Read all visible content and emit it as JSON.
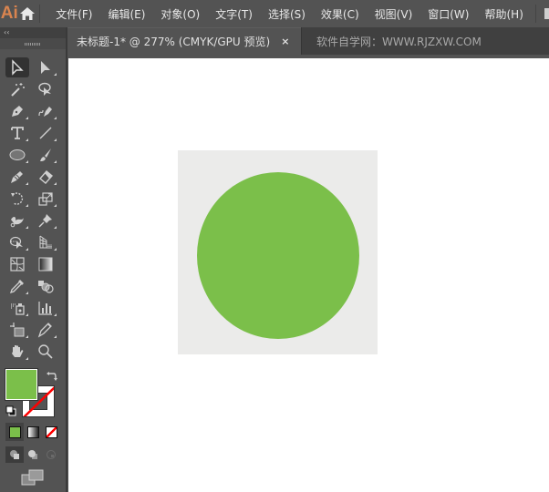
{
  "app": {
    "logo": "Ai",
    "menus": [
      {
        "label": "文件(F)"
      },
      {
        "label": "编辑(E)"
      },
      {
        "label": "对象(O)"
      },
      {
        "label": "文字(T)"
      },
      {
        "label": "选择(S)"
      },
      {
        "label": "效果(C)"
      },
      {
        "label": "视图(V)"
      },
      {
        "label": "窗口(W)"
      },
      {
        "label": "帮助(H)"
      }
    ]
  },
  "tabs": {
    "active": {
      "title": "未标题-1* @ 277% (CMYK/GPU 预览)",
      "close": "×"
    },
    "inactive": {
      "title": "软件自学网：WWW.RJZXW.COM"
    }
  },
  "toolbar": {
    "collapse": "‹‹",
    "tools": [
      [
        "selection-tool",
        "direct-selection-tool"
      ],
      [
        "magic-wand-tool",
        "lasso-tool"
      ],
      [
        "pen-tool",
        "curvature-tool"
      ],
      [
        "type-tool",
        "line-segment-tool"
      ],
      [
        "ellipse-tool",
        "paintbrush-tool"
      ],
      [
        "shaper-tool",
        "eraser-tool"
      ],
      [
        "rotate-tool",
        "scale-tool"
      ],
      [
        "puppet-warp-tool",
        "pin-tool"
      ],
      [
        "shape-builder-tool",
        "perspective-grid-tool"
      ],
      [
        "mesh-tool",
        "gradient-tool"
      ],
      [
        "eyedropper-tool",
        "blend-tool"
      ],
      [
        "symbol-sprayer-tool",
        "column-graph-tool"
      ],
      [
        "artboard-tool",
        "slice-tool"
      ],
      [
        "hand-tool",
        "zoom-tool"
      ]
    ],
    "active_tool": "selection-tool"
  },
  "colors": {
    "fill": "#7bbf4a",
    "stroke": "none",
    "none_color": "#ff0000"
  },
  "artwork": {
    "artboard_color": "#ebebea",
    "circle_color": "#7bbf4a"
  }
}
